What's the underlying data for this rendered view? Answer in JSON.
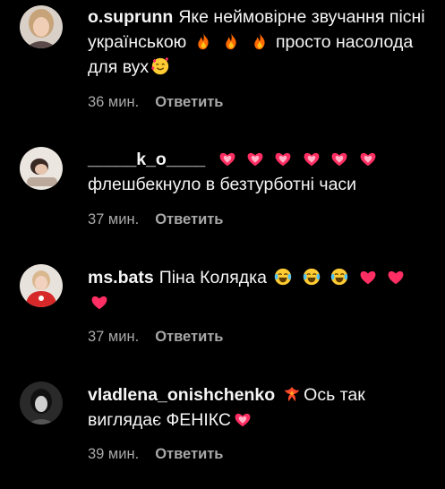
{
  "comments": [
    {
      "username": "o.suprunn",
      "text_a": "Яке неймовірне звучання пісні українською",
      "text_b": "просто насолода для вух",
      "time": "36 мин.",
      "reply_label": "Ответить",
      "avatar_icon": "avatar-woman-blonde",
      "emojis": [
        "fire-icon",
        "fire-icon",
        "fire-icon",
        "smiling-face-with-hearts-icon"
      ]
    },
    {
      "username": "_____k_o____",
      "text_a": "флешбекнуло в безтурботні часи",
      "time": "37 мин.",
      "reply_label": "Ответить",
      "avatar_icon": "avatar-woman-lying",
      "emojis": [
        "heart-on-fire-pink-icon",
        "heart-on-fire-pink-icon",
        "heart-on-fire-pink-icon",
        "heart-on-fire-pink-icon",
        "heart-on-fire-pink-icon",
        "heart-on-fire-pink-icon"
      ]
    },
    {
      "username": "ms.bats",
      "text_a": "Піна Колядка",
      "time": "37 мин.",
      "reply_label": "Ответить",
      "avatar_icon": "avatar-child-red",
      "emojis": [
        "face-with-tears-of-joy-icon",
        "face-with-tears-of-joy-icon",
        "face-with-tears-of-joy-icon",
        "pink-heart-icon",
        "pink-heart-icon",
        "pink-heart-icon"
      ]
    },
    {
      "username": "vladlena_onishchenko",
      "text_a": "Ось так виглядає ФЕНІКС",
      "time": "39 мин.",
      "reply_label": "Ответить",
      "avatar_icon": "avatar-bw-portrait",
      "emojis": [
        "phoenix-icon",
        "heart-on-fire-pink-icon"
      ]
    }
  ],
  "colors": {
    "background": "#000000",
    "text": "#f5f5f5",
    "secondary": "#a8a8a8",
    "heart": "#ff2e63",
    "fire": "#ff6a00"
  }
}
